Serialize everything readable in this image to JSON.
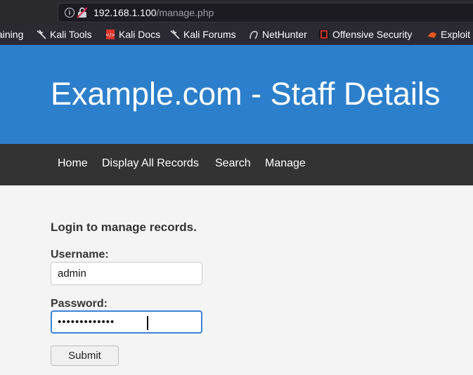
{
  "browser": {
    "url_host": "192.168.1.100",
    "url_path": "/manage.php"
  },
  "bookmarks": [
    {
      "label": "aining",
      "icon": "none"
    },
    {
      "label": "Kali Tools",
      "icon": "kali-dragon-icon"
    },
    {
      "label": "Kali Docs",
      "icon": "kali-docs-icon"
    },
    {
      "label": "Kali Forums",
      "icon": "kali-dragon-icon"
    },
    {
      "label": "NetHunter",
      "icon": "nethunter-icon"
    },
    {
      "label": "Offensive Security",
      "icon": "offsec-icon"
    },
    {
      "label": "Exploit",
      "icon": "exploit-db-icon"
    }
  ],
  "header": {
    "title": "Example.com - Staff Details"
  },
  "nav": {
    "items": [
      "Home",
      "Display All Records",
      "Search",
      "Manage"
    ]
  },
  "form": {
    "heading": "Login to manage records.",
    "username_label": "Username:",
    "username_value": "admin",
    "password_label": "Password:",
    "password_value": "•••••••••••••",
    "submit_label": "Submit"
  },
  "colors": {
    "header_bg": "#2c7fcb",
    "nav_bg": "#333333",
    "focus_border": "#3a83d6"
  }
}
